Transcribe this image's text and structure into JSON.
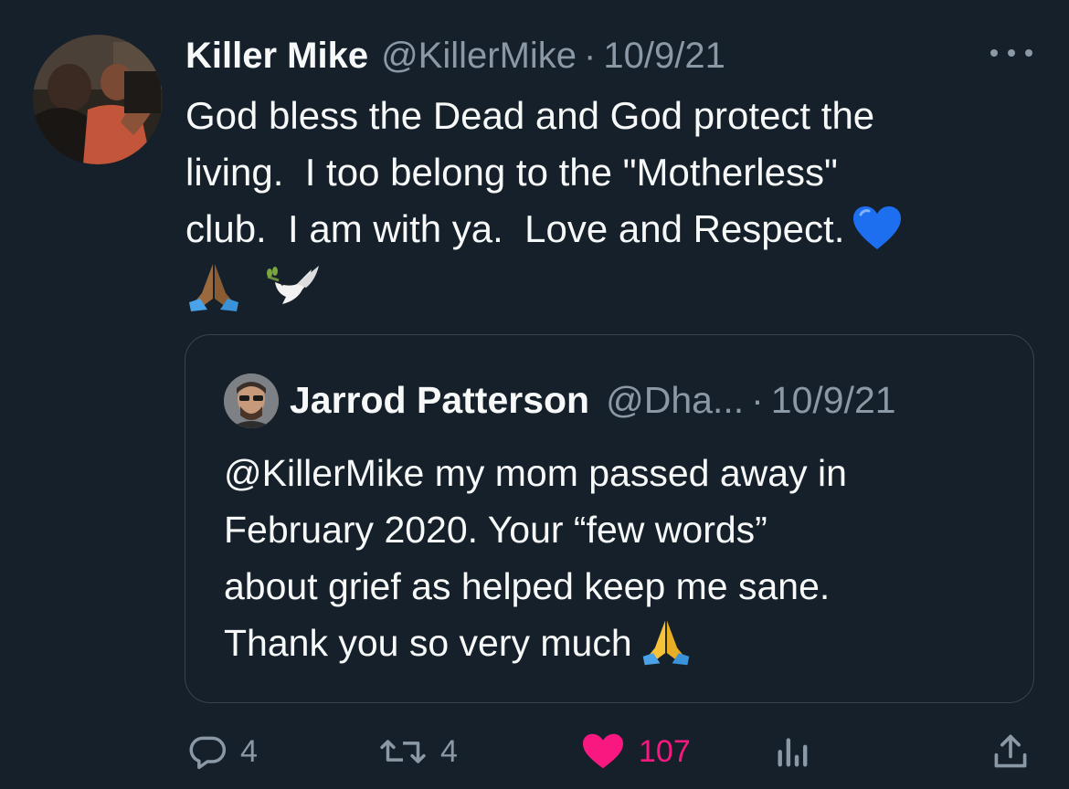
{
  "tweet": {
    "author_name": "Killer Mike",
    "author_handle": "@KillerMike",
    "separator": "·",
    "date": "10/9/21",
    "text_lines": [
      "God bless the Dead and God protect the",
      "living.  I too belong to the \"Motherless\"",
      "club.  I am with ya.  Love and Respect."
    ],
    "emojis": [
      "blue-heart",
      "folded-hands",
      "dove"
    ]
  },
  "quoted_tweet": {
    "author_name": "Jarrod Patterson",
    "author_handle": "@Dha...",
    "separator": "·",
    "date": "10/9/21",
    "text_lines": [
      "@KillerMike my mom passed away in",
      "February 2020. Your “few words”",
      "about grief as helped keep me sane.",
      "Thank you so very much"
    ],
    "emojis": [
      "folded-hands"
    ]
  },
  "actions": {
    "reply_count": "4",
    "retweet_count": "4",
    "like_count": "107",
    "views_count": "",
    "like_color": "#f91880",
    "muted_color": "#8b98a5"
  },
  "icons": [
    "more-icon",
    "reply-icon",
    "retweet-icon",
    "like-icon",
    "views-icon",
    "share-icon"
  ]
}
